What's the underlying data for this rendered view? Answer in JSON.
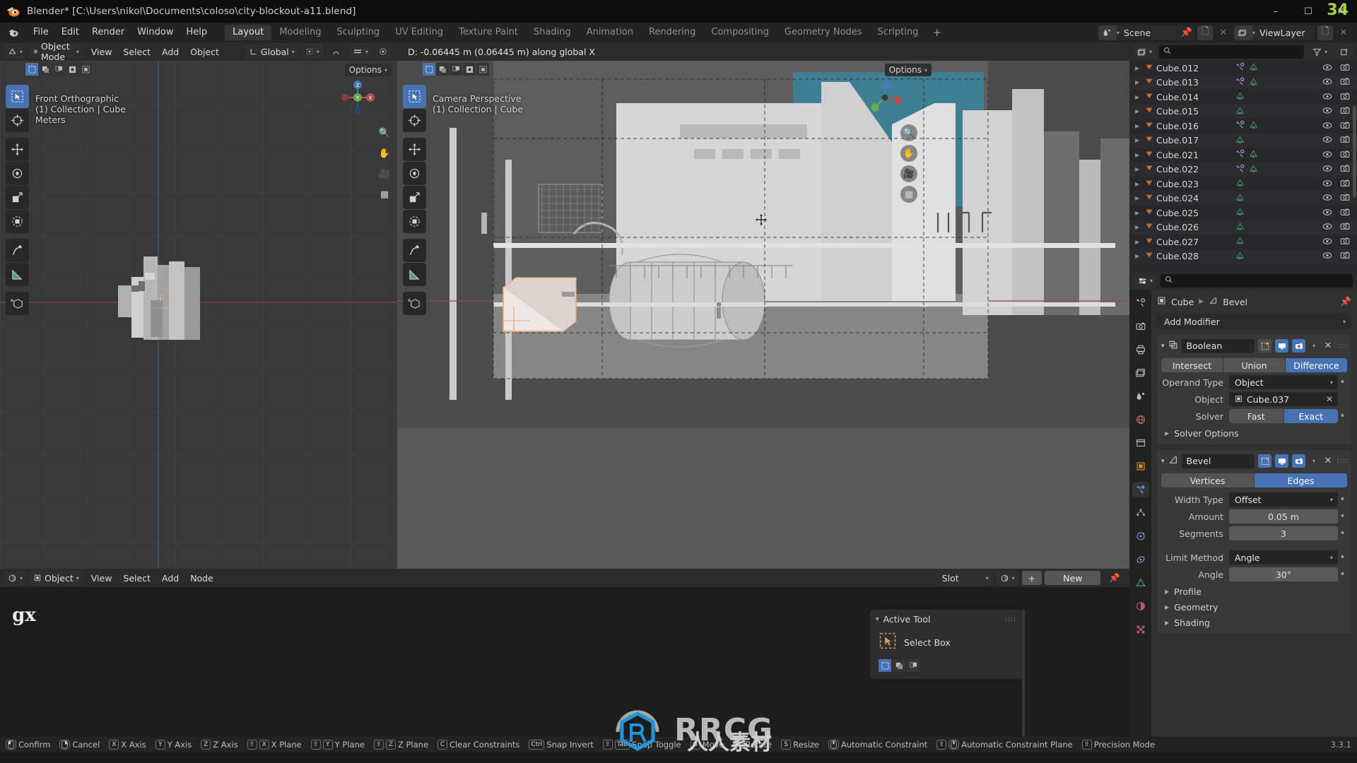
{
  "titlebar": {
    "title": "Blender* [C:\\Users\\nikol\\Documents\\coloso\\city-blockout-a11.blend]",
    "minimize": "–",
    "maximize": "☐",
    "close": "✕",
    "badge": "34"
  },
  "topbar": {
    "menus": [
      "File",
      "Edit",
      "Render",
      "Window",
      "Help"
    ],
    "workspaces": [
      {
        "label": "Layout",
        "active": true
      },
      {
        "label": "Modeling",
        "active": false
      },
      {
        "label": "Sculpting",
        "active": false
      },
      {
        "label": "UV Editing",
        "active": false
      },
      {
        "label": "Texture Paint",
        "active": false
      },
      {
        "label": "Shading",
        "active": false
      },
      {
        "label": "Animation",
        "active": false
      },
      {
        "label": "Rendering",
        "active": false
      },
      {
        "label": "Compositing",
        "active": false
      },
      {
        "label": "Geometry Nodes",
        "active": false
      },
      {
        "label": "Scripting",
        "active": false
      },
      {
        "label": "+",
        "active": false
      }
    ],
    "scene_name": "Scene",
    "viewlayer_name": "ViewLayer"
  },
  "viewport_header": {
    "mode": "Object Mode",
    "menus": [
      "View",
      "Select",
      "Add",
      "Object"
    ],
    "orientation": "Global",
    "options_label": "Options"
  },
  "viewport_left": {
    "view_name": "Front Orthographic",
    "collection": "(1) Collection | Cube",
    "units": "Meters",
    "options_label": "Options"
  },
  "viewport_right": {
    "view_name": "Camera Perspective",
    "collection": "(1) Collection | Cube",
    "options_label": "Options",
    "transform_info": "D: -0.06445 m (0.06445 m) along global X"
  },
  "shader_editor": {
    "editor_type": "shader-editor",
    "shader_type": "Object",
    "menus": [
      "View",
      "Select",
      "Add",
      "Node"
    ],
    "slot_label": "Slot",
    "add_label": "+",
    "new_label": "New",
    "sidebar": {
      "panel_title": "Active Tool",
      "tool_name": "Select Box"
    }
  },
  "outliner": {
    "search_placeholder": "",
    "items": [
      {
        "name": "Cube.012",
        "has_modifier": true
      },
      {
        "name": "Cube.013",
        "has_modifier": true
      },
      {
        "name": "Cube.014",
        "has_modifier": false
      },
      {
        "name": "Cube.015",
        "has_modifier": false
      },
      {
        "name": "Cube.016",
        "has_modifier": true
      },
      {
        "name": "Cube.017",
        "has_modifier": false
      },
      {
        "name": "Cube.021",
        "has_modifier": true
      },
      {
        "name": "Cube.022",
        "has_modifier": true
      },
      {
        "name": "Cube.023",
        "has_modifier": false
      },
      {
        "name": "Cube.024",
        "has_modifier": false
      },
      {
        "name": "Cube.025",
        "has_modifier": false
      },
      {
        "name": "Cube.026",
        "has_modifier": false
      },
      {
        "name": "Cube.027",
        "has_modifier": false
      },
      {
        "name": "Cube.028",
        "has_modifier": false
      }
    ]
  },
  "properties": {
    "breadcrumb": {
      "object": "Cube",
      "modifier": "Bevel"
    },
    "add_modifier_label": "Add Modifier",
    "boolean": {
      "name": "Boolean",
      "operations": [
        {
          "label": "Intersect",
          "active": false
        },
        {
          "label": "Union",
          "active": false
        },
        {
          "label": "Difference",
          "active": true
        }
      ],
      "operand_type_label": "Operand Type",
      "operand_type_value": "Object",
      "object_label": "Object",
      "object_value": "Cube.037",
      "solver_label": "Solver",
      "solvers": [
        {
          "label": "Fast",
          "active": false
        },
        {
          "label": "Exact",
          "active": true
        }
      ],
      "solver_options_label": "Solver Options"
    },
    "bevel": {
      "name": "Bevel",
      "modes": [
        {
          "label": "Vertices",
          "active": false
        },
        {
          "label": "Edges",
          "active": true
        }
      ],
      "width_type_label": "Width Type",
      "width_type_value": "Offset",
      "amount_label": "Amount",
      "amount_value": "0.05 m",
      "segments_label": "Segments",
      "segments_value": "3",
      "limit_method_label": "Limit Method",
      "limit_method_value": "Angle",
      "angle_label": "Angle",
      "angle_value": "30°",
      "subpanels": [
        "Profile",
        "Geometry",
        "Shading"
      ]
    }
  },
  "statusbar": {
    "items": [
      {
        "keys": [
          "mouse-left"
        ],
        "label": "Confirm"
      },
      {
        "keys": [
          "mouse-right"
        ],
        "label": "Cancel"
      },
      {
        "keys": [
          "X"
        ],
        "label": "X Axis"
      },
      {
        "keys": [
          "Y"
        ],
        "label": "Y Axis"
      },
      {
        "keys": [
          "Z"
        ],
        "label": "Z Axis"
      },
      {
        "keys": [
          "⇧",
          "X"
        ],
        "label": "X Plane"
      },
      {
        "keys": [
          "⇧",
          "Y"
        ],
        "label": "Y Plane"
      },
      {
        "keys": [
          "⇧",
          "Z"
        ],
        "label": "Z Plane"
      },
      {
        "keys": [
          "C"
        ],
        "label": "Clear Constraints"
      },
      {
        "keys": [
          "Ctrl"
        ],
        "label": "Snap Invert"
      },
      {
        "keys": [
          "⇧",
          "Tab"
        ],
        "label": "Snap Toggle"
      },
      {
        "keys": [
          "G"
        ],
        "label": "Move"
      },
      {
        "keys": [
          "R"
        ],
        "label": "Rotate"
      },
      {
        "keys": [
          "S"
        ],
        "label": "Resize"
      },
      {
        "keys": [
          "mouse-mid"
        ],
        "label": "Automatic Constraint"
      },
      {
        "keys": [
          "⇧",
          "mouse-mid"
        ],
        "label": "Automatic Constraint Plane"
      },
      {
        "keys": [
          "⇧"
        ],
        "label": "Precision Mode"
      }
    ],
    "version": "3.3.1"
  },
  "watermark": {
    "brand": "RRCG",
    "sub": "人人素材",
    "corner_logo": "gx"
  },
  "colors": {
    "accent_blue": "#4772b3",
    "panel_bg": "#303030",
    "header_bg": "#2b2b2b",
    "viewport_bg": "#393939",
    "outliner_orange": "#cf7c3a",
    "mesh_green": "#3e8a6a"
  }
}
